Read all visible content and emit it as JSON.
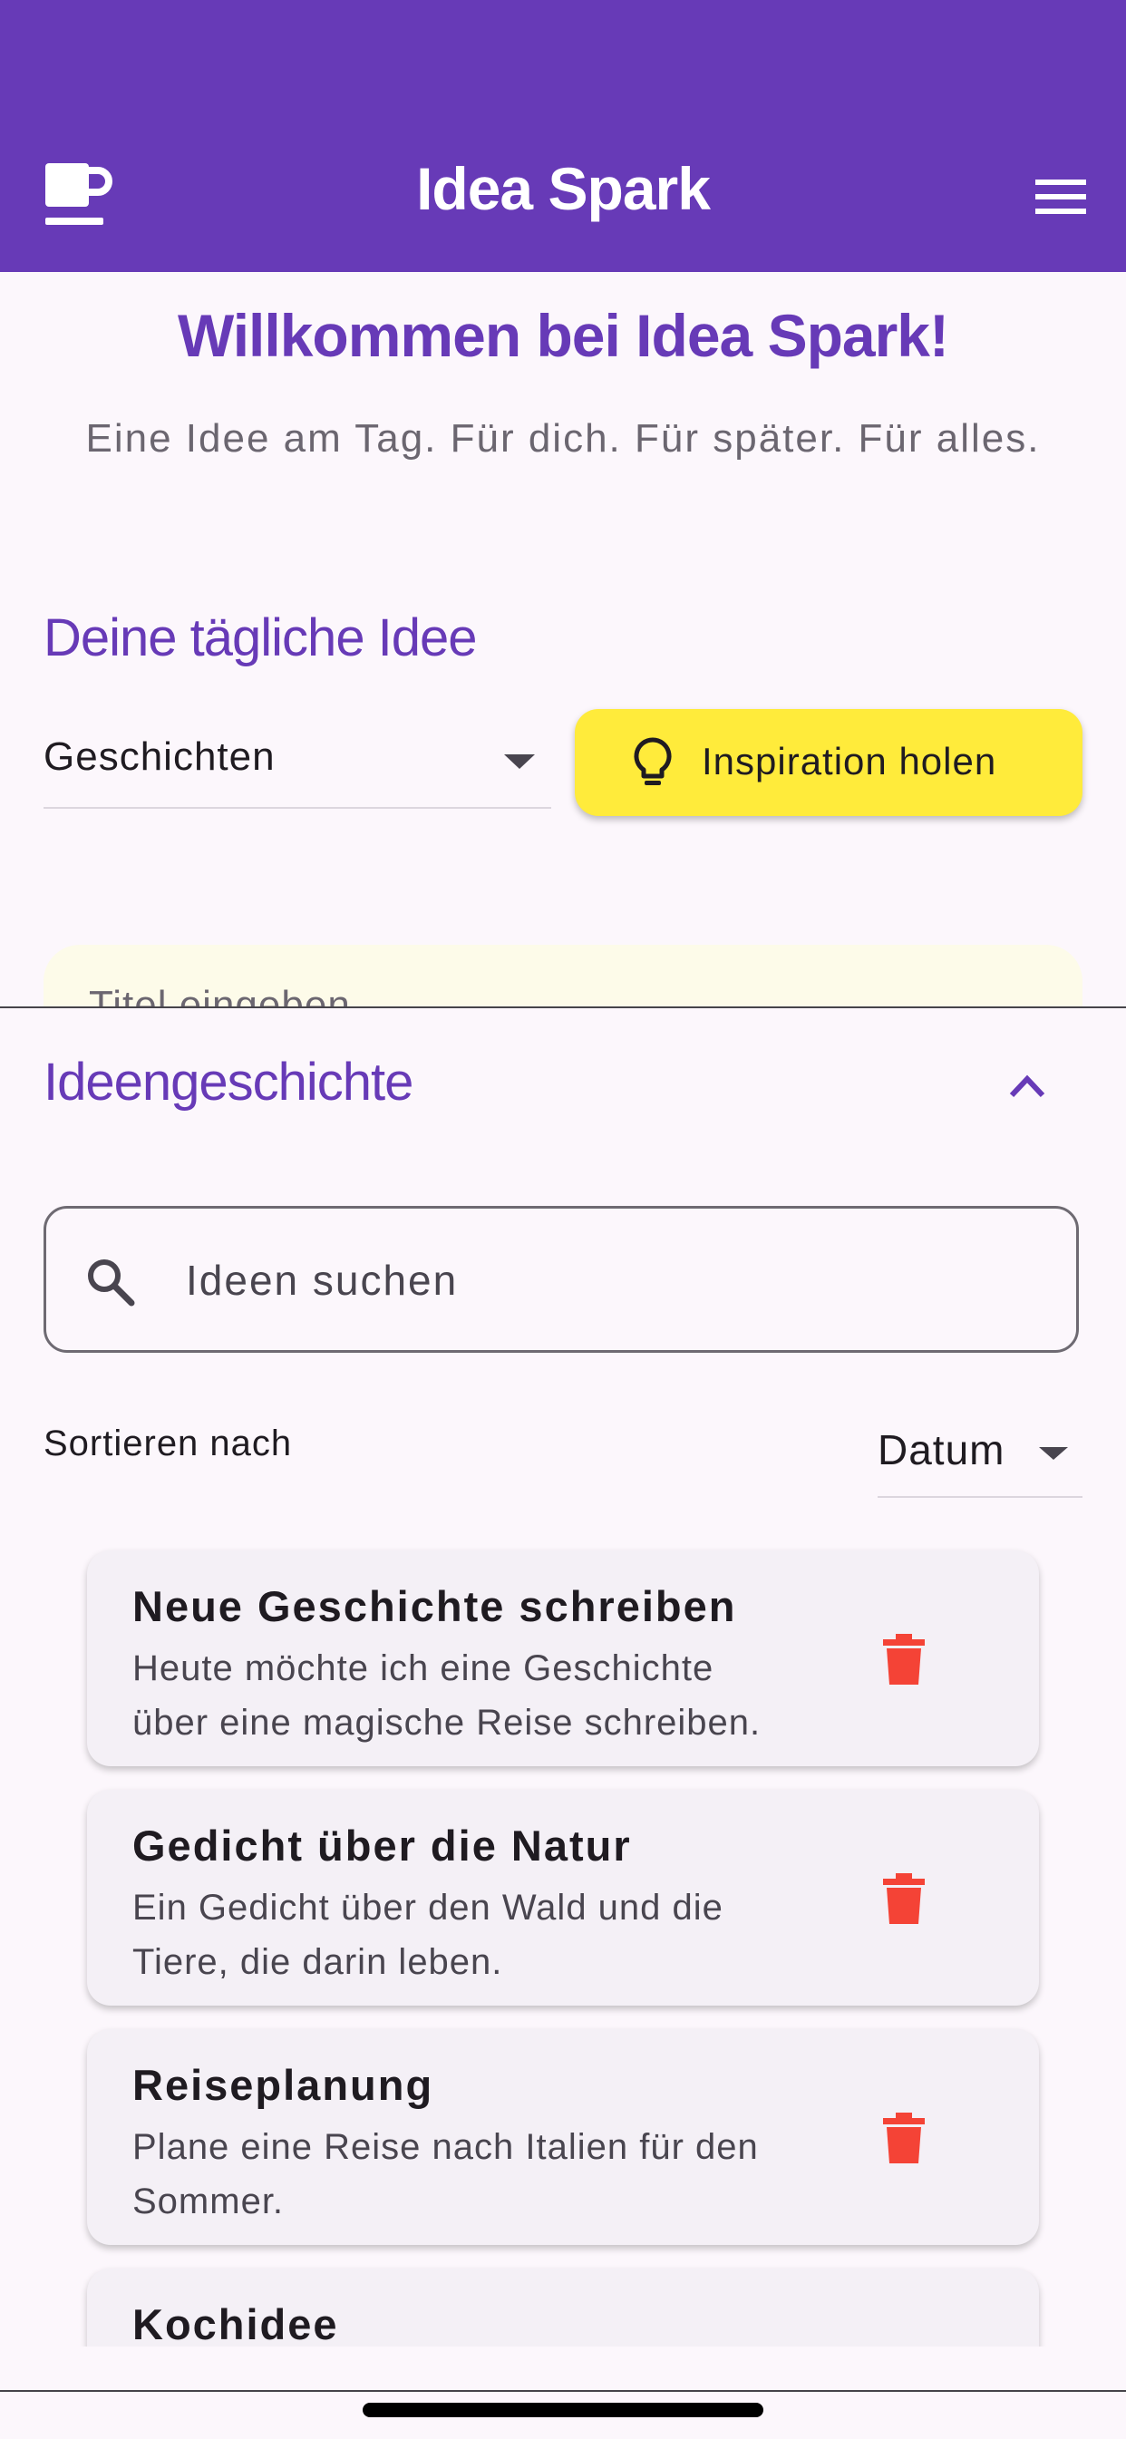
{
  "app_bar": {
    "title": "Idea Spark",
    "leading_icon": "coffee-cup-icon",
    "trailing_icon": "hamburger-menu-icon",
    "background": "#673ab7"
  },
  "welcome": {
    "title": "Willkommen bei Idea Spark!",
    "subtitle": "Eine Idee am Tag. Für dich. Für später. Für alles."
  },
  "daily_idea": {
    "section_title": "Deine tägliche Idee",
    "category_selected": "Geschichten",
    "inspire_button": "Inspiration holen",
    "inspire_icon": "lightbulb-icon",
    "card_peek_text": "Titel eingeben"
  },
  "history": {
    "title": "Ideengeschichte",
    "collapse_icon": "chevron-up-icon",
    "search_placeholder": "Ideen suchen",
    "sort_label": "Sortieren nach",
    "sort_selected": "Datum",
    "items": [
      {
        "title": "Neue Geschichte schreiben",
        "description": "Heute möchte ich eine Geschichte über eine magische Reise schreiben."
      },
      {
        "title": "Gedicht über die Natur",
        "description": "Ein Gedicht über den Wald und die Tiere, die darin leben."
      },
      {
        "title": "Reiseplanung",
        "description": "Plane eine Reise nach Italien für den Sommer."
      },
      {
        "title": "Kochidee",
        "description": ""
      }
    ]
  },
  "colors": {
    "primary": "#673ab7",
    "accent_button": "#ffeb3b",
    "delete": "#f44336",
    "idea_card": "#fdfbe9"
  }
}
